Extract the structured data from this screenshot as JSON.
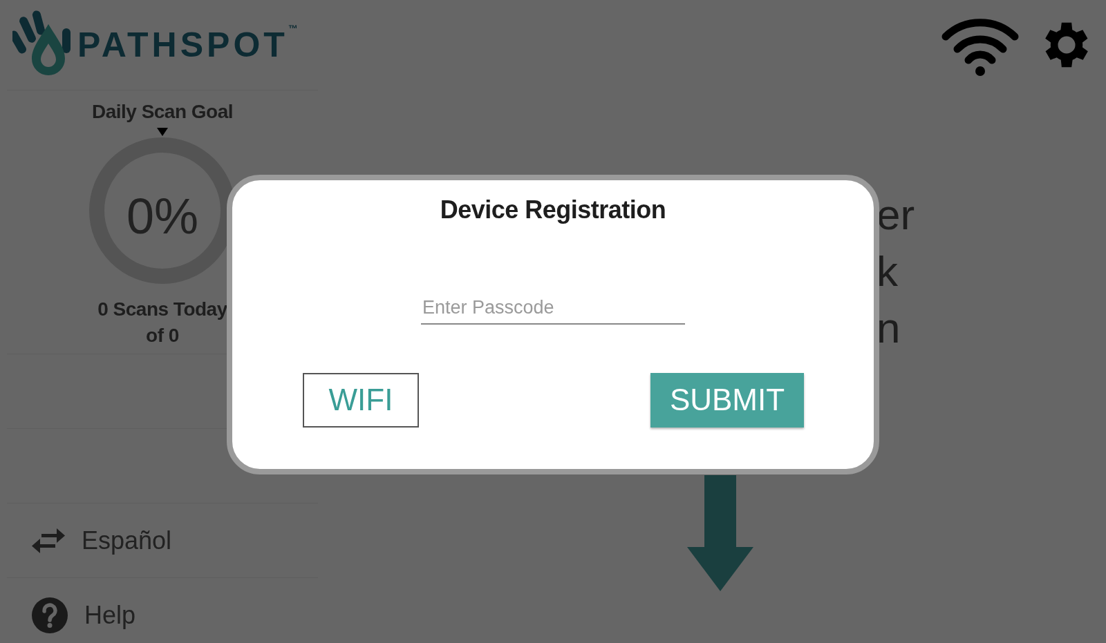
{
  "logo": {
    "text": "PATHSPOT",
    "trademark": "™"
  },
  "sidebar": {
    "goal": {
      "title": "Daily Scan Goal",
      "percent": "0%",
      "level": 0,
      "scans": "0 Scans Today",
      "of": "of 0"
    },
    "items": [
      {
        "kind": "language",
        "label": "Español"
      },
      {
        "kind": "help",
        "label": "Help"
      }
    ]
  },
  "background_text": [
    "er",
    "k",
    "n"
  ],
  "dialog": {
    "title": "Device Registration",
    "passcode": {
      "placeholder": "Enter Passcode"
    },
    "buttons": [
      {
        "kind": "outline",
        "label": "WIFI"
      },
      {
        "kind": "primary",
        "label": "SUBMIT"
      }
    ]
  }
}
